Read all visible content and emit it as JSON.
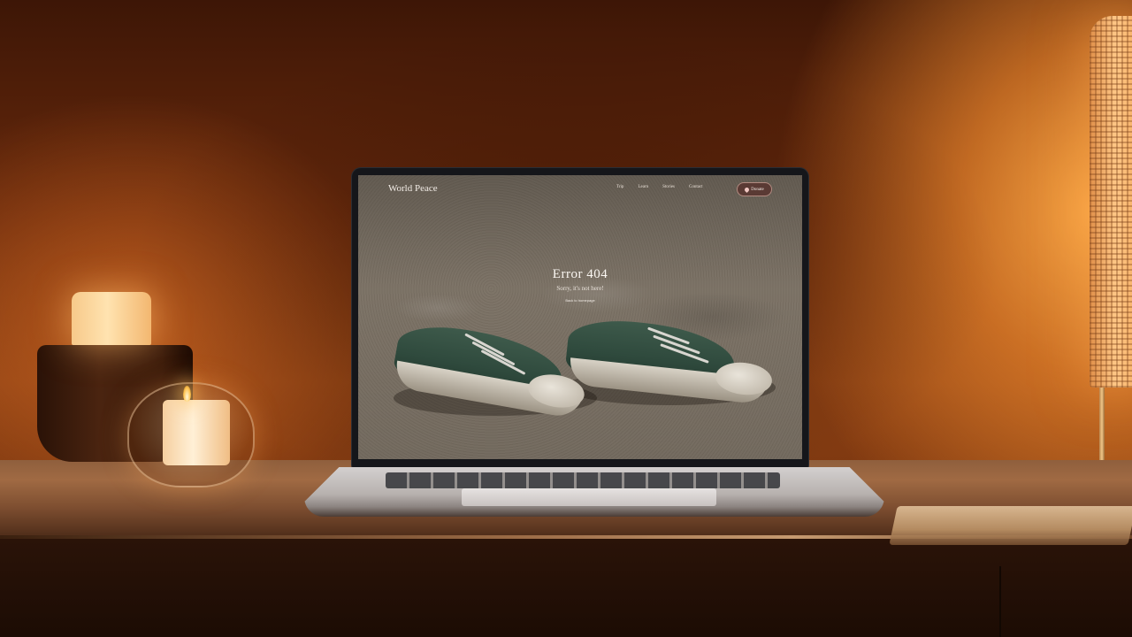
{
  "site": {
    "brand": "World Peace",
    "nav": {
      "items": [
        "Trip",
        "Learn",
        "Stories",
        "Contact"
      ]
    },
    "donate_label": "Donate"
  },
  "error": {
    "title": "Error 404",
    "subtitle": "Sorry, it's not here!",
    "link": "Back to homepage"
  },
  "colors": {
    "screen_sand": "#7b7265",
    "shoe_green": "#3e5a4b",
    "donate_button": "#5a3a34",
    "ambient_glow": "#f3a85d"
  },
  "icons": [
    "heart-icon"
  ]
}
